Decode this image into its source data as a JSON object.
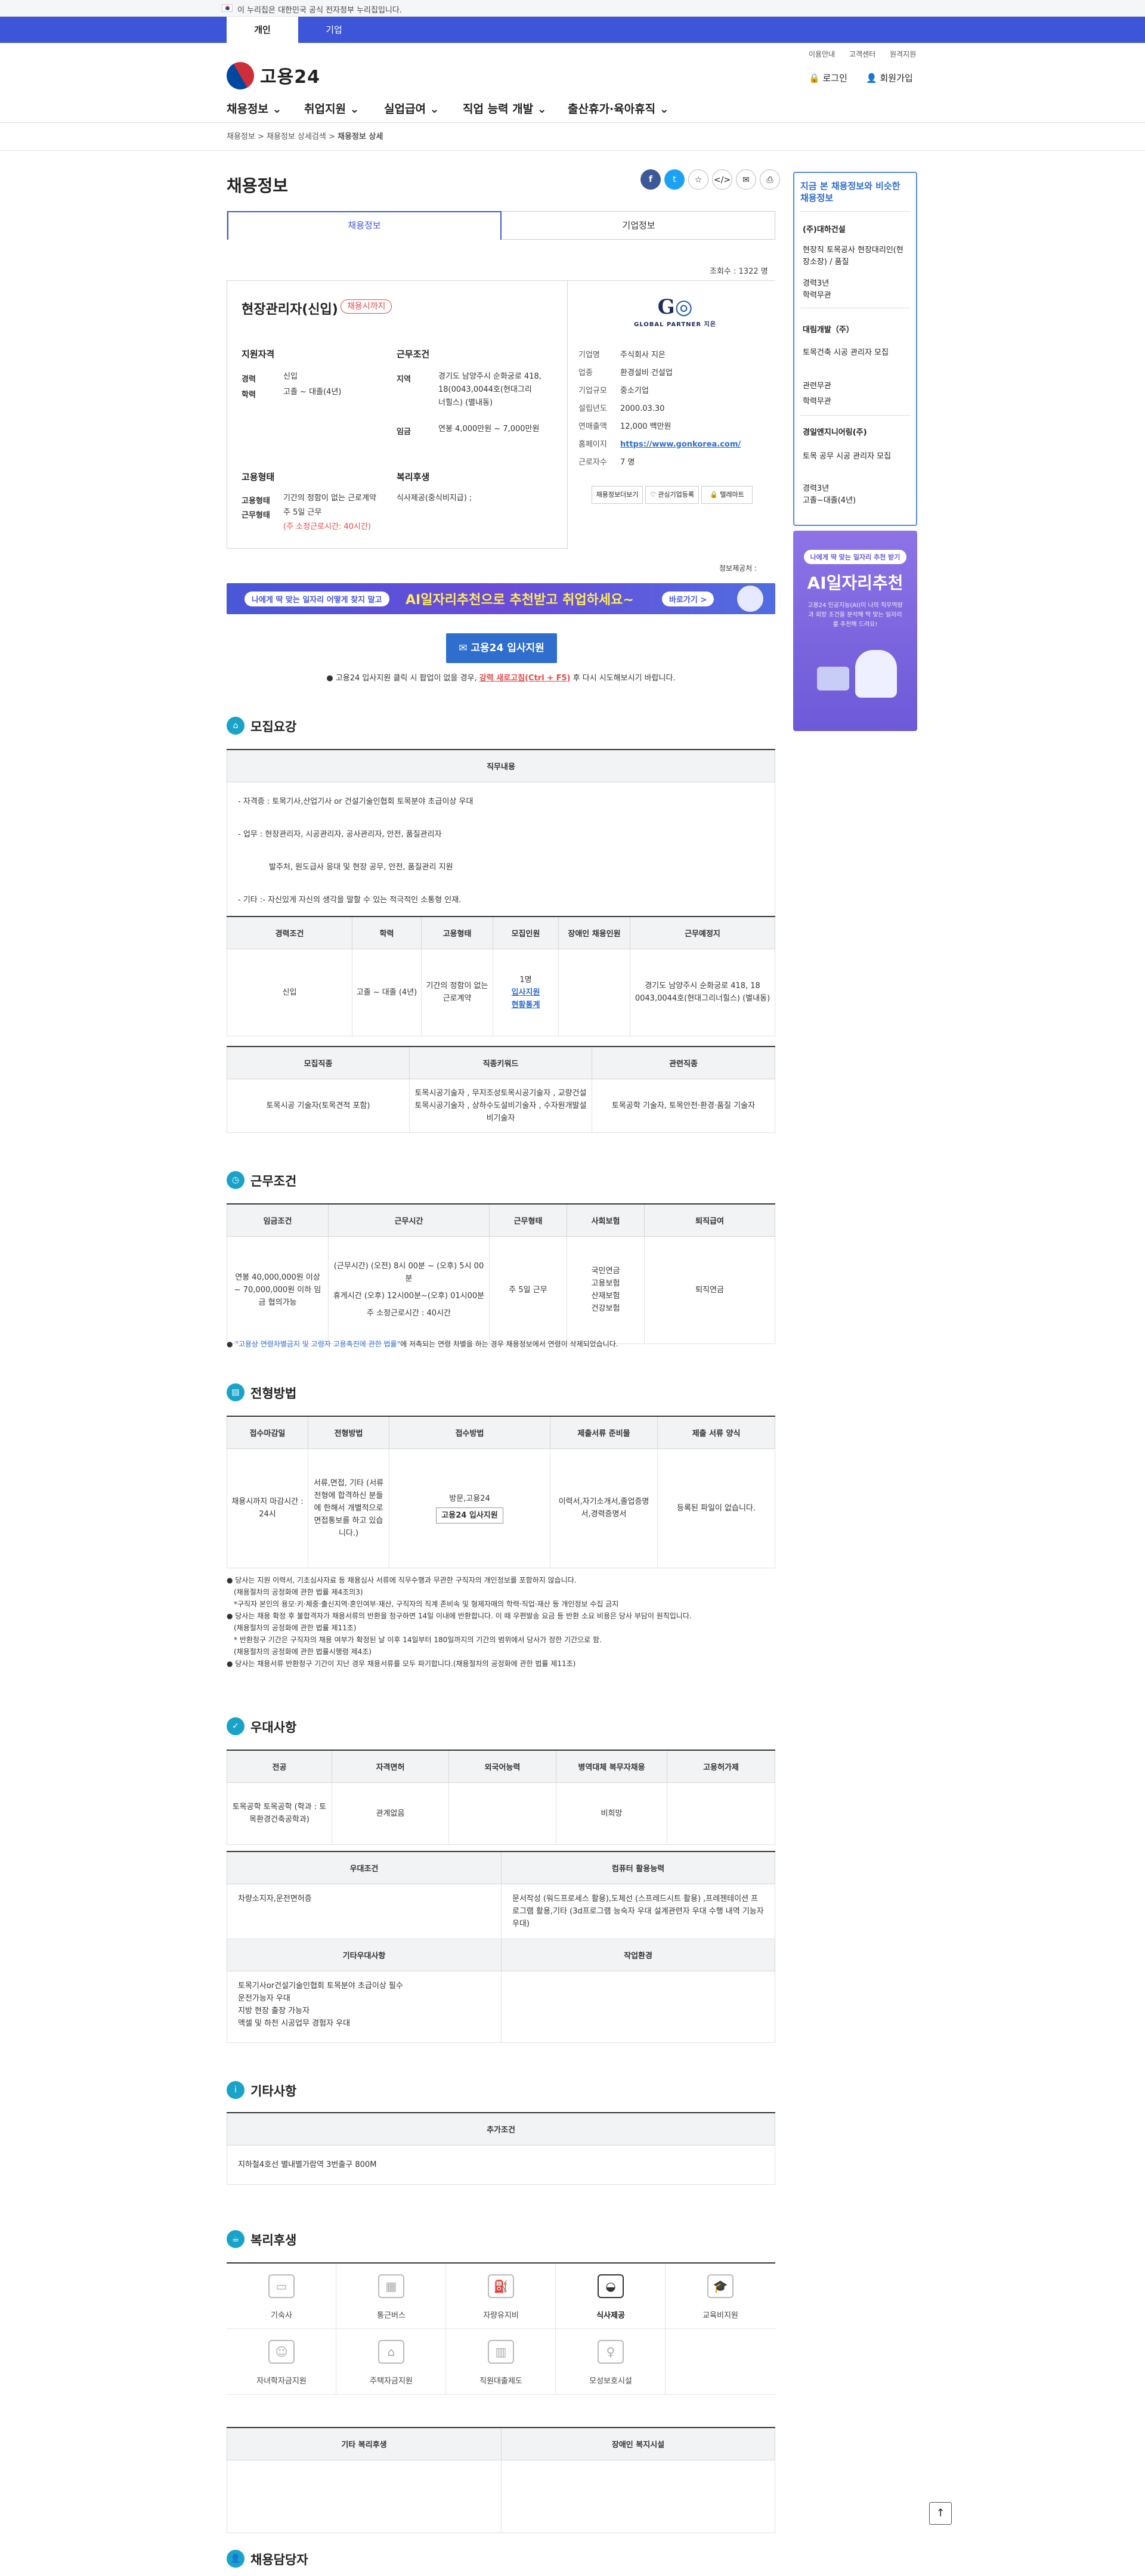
{
  "gov_bar": {
    "text": "이 누리집은 대한민국 공식 전자정부 누리집입니다."
  },
  "primary_tabs": [
    {
      "label": "개인"
    },
    {
      "label": "기업"
    }
  ],
  "util_links": [
    "이용안내",
    "고객센터",
    "원격지원"
  ],
  "logo": {
    "text": "고용24"
  },
  "header_buttons": {
    "login": "로그인",
    "signup": "회원가입"
  },
  "gnb": [
    "채용정보",
    "취업지원",
    "실업급여",
    "직업 능력 개발",
    "출산휴가·육아휴직"
  ],
  "breadcrumb": {
    "items": [
      "채용정보",
      "채용정보 상세검색"
    ],
    "current": "채용정보 상세"
  },
  "page_title": "채용정보",
  "share_icons": [
    "facebook-icon",
    "twitter-icon",
    "star-icon",
    "code-icon",
    "mail-icon",
    "print-icon"
  ],
  "tabs": {
    "tab1": "채용정보",
    "tab2": "기업정보"
  },
  "views": "조회수 : 1322 명",
  "job": {
    "title": "현장관리자(신입)",
    "status": "채용시까지",
    "qual_heading": "지원자격",
    "career_label": "경력",
    "career_value": "신입",
    "edu_label": "학력",
    "edu_value": "고졸 ~ 대졸(4년)",
    "cond_heading": "근무조건",
    "region_label": "지역",
    "region_value1": "경기도 남양주시 순화궁로 418,",
    "region_value2": "18(0043,0044호(현대그리",
    "region_value3": "너힐스) (별내동)",
    "wage_label": "임금",
    "wage_value": "연봉 4,000만원 ~ 7,000만원",
    "emp_heading": "고용형태",
    "emp_label": "고용형태",
    "emp_value": "기간의 정함이 없는 근로계약",
    "work_label": "근무형태",
    "work_value": "주 5일 근무",
    "work_hours": "(주 소정근로시간: 40시간)",
    "welfare_heading": "복리후생",
    "welfare_value": "식사제공(중식비지급) ;"
  },
  "company": {
    "logo_text": "GLOBAL PARTNER 지은",
    "rows": [
      {
        "k": "기업명",
        "v": "주식회사 지은"
      },
      {
        "k": "업종",
        "v": "환경설비 건설업"
      },
      {
        "k": "기업규모",
        "v": "중소기업"
      },
      {
        "k": "설립년도",
        "v": "2000.03.30"
      },
      {
        "k": "연매출액",
        "v": "12,000 백만원"
      },
      {
        "k": "홈페이지",
        "v": "https://www.gonkorea.com/"
      },
      {
        "k": "근로자수",
        "v": "7 명"
      }
    ],
    "btn1": "채용정보더보기",
    "btn2": "관심기업등록",
    "btn3": "텔레마트"
  },
  "info_provider": "정보제공처 : ",
  "banner": {
    "text1": "나에게 딱 맞는 일자리 어떻게 찾지 말고",
    "text2": "AI일자리추천으로 추천받고 취업하세요~",
    "btn": "바로가기 >"
  },
  "apply": {
    "button": "고용24 입사지원",
    "note_pre": "● 고용24 입사지원 클릭 시 팝업이 없을 경우, ",
    "note_link": "강력 새로고침(Ctrl + F5)",
    "note_post": " 후 다시 시도해보시기 바랍니다."
  },
  "sec_recruit": {
    "title": "모집요강",
    "duty_header": "직무내용",
    "duty_lines": [
      "- 자격증 : 토목기사,산업기사 or 건설기술인협회 토목분야 초급이상 우대",
      "- 업무 : 현장관리자, 시공관리자, 공사관리자, 안전, 품질관리자",
      "발주처, 원도급사 응대 및 현장 공무, 안전, 품질관리 지원",
      "- 기타 :- 자신있게 자신의 생각을 말할 수 있는 적극적인 소통형 인재."
    ],
    "cond_headers": [
      "경력조건",
      "학력",
      "고용형태",
      "모집인원",
      "장애인 채용인원",
      "근무예정지"
    ],
    "cond_row": {
      "career": "신입",
      "edu": "고졸 ~ 대졸 (4년)",
      "emp": "기간의 정함이 없는 근로계약",
      "count": "1명",
      "count_link1": "입사지원",
      "count_link2": "현황통계",
      "disabled": "",
      "place": "경기도 남양주시 순화궁로 418, 18 0043,0044호(현대그리너힐스) (별내동)"
    },
    "job_headers": [
      "모집직종",
      "직종키워드",
      "관련직종"
    ],
    "job_row": {
      "job": "토목시공 기술자(토목견적 포함)",
      "keyword": "토목시공기술자 , 무지조성토목시공기술자 , 교량건설토목시공기술자 , 상하수도설비기술자 , 수자원개발설비기술자",
      "related": "토목공학 기술자, 토목안전·환경·품질 기술자"
    }
  },
  "sec_work": {
    "title": "근무조건",
    "headers": [
      "임금조건",
      "근무시간",
      "근무형태",
      "사회보험",
      "퇴직급여"
    ],
    "wage": "연봉 40,000,000원 이상 ~ 70,000,000원 이하 임금 협의가능",
    "hours1": "(근무시간) (오전) 8시 00분 ~ (오후) 5시 00분",
    "hours2": "휴게시간 (오후) 12시00분~(오후) 01시00분",
    "hours3": "주 소정근로시간 : 40시간",
    "shift": "주 5일 근무",
    "insurance": [
      "국민연금",
      "고용보험",
      "산재보험",
      "건강보험"
    ],
    "retire": "퇴직연금",
    "note_link": "\"고용상 연령차별금지 및 고령자 고용촉진에 관한 법률\"",
    "note_text": "에 저촉되는 연령 차별을 하는 경우 채용정보에서 연령이 삭제되었습니다."
  },
  "sec_select": {
    "title": "전형방법",
    "headers": [
      "접수마감일",
      "전형방법",
      "접수방법",
      "제출서류 준비물",
      "제출 서류 양식"
    ],
    "deadline": "채용시까지 마감시간 : 24시",
    "method": "서류,면접, 기타 (서류전형에 합격하신 분들에 한해서 개별적으로 면접통보를 하고 있습니다.)",
    "receipt": "방문,고용24",
    "receipt_btn": "고용24 입사지원",
    "docs": "이력서,자기소개서,졸업증명서,경력증명서",
    "form": "등록된 파일이 없습니다.",
    "bullets": [
      "당사는 지원 이력서, 기초심사자료 등 채용심사 서류에 직무수행과 무관한 구직자의 개인정보를 포함하지 않습니다.",
      "(채용절차의 공정화에 관한 법률 제4조의3)",
      "*구직자 본인의 용모·키·체중·출신지역·혼인여부·재산, 구직자의 직계 존비속 및 형제자매의 학력·직업·재산 등 개인정보 수집 금지",
      "당사는 채용 확정 후 불합격자가 채용서류의 반환을 청구하면 14일 이내에 반환합니다. 이 때 우편발송 요금 등 반환 소요 비용은 당사 부담이 원칙입니다.",
      "(채용절차의 공정화에 관한 법률 제11조)",
      "* 반환청구 기간은 구직자의 채용 여부가 확정된 날 이후 14일부터 180일까지의 기간의 범위에서 당사가 정한 기간으로 함.",
      "(채용절차의 공정화에 관한 법률시행령 제4조)",
      "당사는 채용서류 반환청구 기간이 지난 경우 채용서류를 모두 파기합니다.(채용절차의 공정화에 관한 법률 제11조)"
    ]
  },
  "sec_pref": {
    "title": "우대사항",
    "headers": [
      "전공",
      "자격면허",
      "외국어능력",
      "병역대체 복무자채용",
      "고용허가제"
    ],
    "major": "토목공학 토목공학 (학과 : 토목환경건축공학과)",
    "license": "관계없음",
    "lang": "",
    "military": "비희망",
    "permit": "",
    "cond_h": "우대조건",
    "cond_v": "차량소지자,운전면허증",
    "comp_h": "컴퓨터 활용능력",
    "comp_v": "문서작성 (워드프로세스 활용),도체선 (스프레드시트 활용) ,프레젠테이션 프로그램 활용,기타 (3d프로그램 능숙자 우대 설계관련자 우대 수행 내역 기능자 우대)",
    "etc_h": "기타우대사항",
    "etc_v": [
      "토목기사or건설기술인협회 토목분야 초급이상 필수",
      "운전가능자 우대",
      "지방 현장 출장 가능자",
      "액셀 및 하천 시공업무 경험자 우대"
    ],
    "env_h": "작업환경",
    "env_v": ""
  },
  "sec_etc": {
    "title": "기타사항",
    "header": "추가조건",
    "value": "지하철4호선 별내별가람역 3번출구 800M"
  },
  "sec_welfare": {
    "title": "복리후생",
    "items": [
      {
        "label": "기숙사",
        "icon": "bed-icon",
        "on": false
      },
      {
        "label": "통근버스",
        "icon": "bus-icon",
        "on": false
      },
      {
        "label": "자량유지비",
        "icon": "car-icon",
        "on": false
      },
      {
        "label": "식사제공",
        "icon": "meal-icon",
        "on": true
      },
      {
        "label": "교육비지원",
        "icon": "graduation-icon",
        "on": false
      },
      {
        "label": "자녀학자금지원",
        "icon": "child-icon",
        "on": false
      },
      {
        "label": "주택자금지원",
        "icon": "house-icon",
        "on": false
      },
      {
        "label": "직원대출제도",
        "icon": "loan-icon",
        "on": false
      },
      {
        "label": "모성보호시설",
        "icon": "mother-icon",
        "on": false
      },
      {
        "label": "",
        "icon": "",
        "on": false
      }
    ],
    "other_h": "기타 복리후생",
    "disabled_h": "장애인 복지시설"
  },
  "sec_contact": {
    "title": "채용담당자"
  },
  "side": {
    "heading": "지금 본 채용정보와 비슷한 채용정보",
    "items": [
      {
        "company": "(주)대하건설",
        "title": "현장직 토목공사 현장대리인(현장소장) / 품질",
        "meta1": "경력3년",
        "meta2": "학력무관"
      },
      {
        "company": "대림개발（주）",
        "title": "토목건축 시공 관리자 모집",
        "meta1": "관련무관",
        "meta2": "학력무관"
      },
      {
        "company": "경일엔지니어링(주)",
        "title": "토목 공무 시공 관리자 모집",
        "meta1": "경력3년",
        "meta2": "고졸~대졸(4년)"
      }
    ]
  },
  "side_ad": {
    "pill": "나에게 딱 맞는 일자리 추천 받기",
    "title": "AI일자리추천",
    "desc": "고용24 인공지능(AI)이 나의 직무역량과 희망 조건을 분석해 딱 맞는 일자리를 추천해 드려요!"
  },
  "colors": {
    "brand_blue": "#3d56d7",
    "accent_blue": "#2f6ecd",
    "section_teal": "#1aa3c8",
    "status_red": "#e34a4a"
  }
}
